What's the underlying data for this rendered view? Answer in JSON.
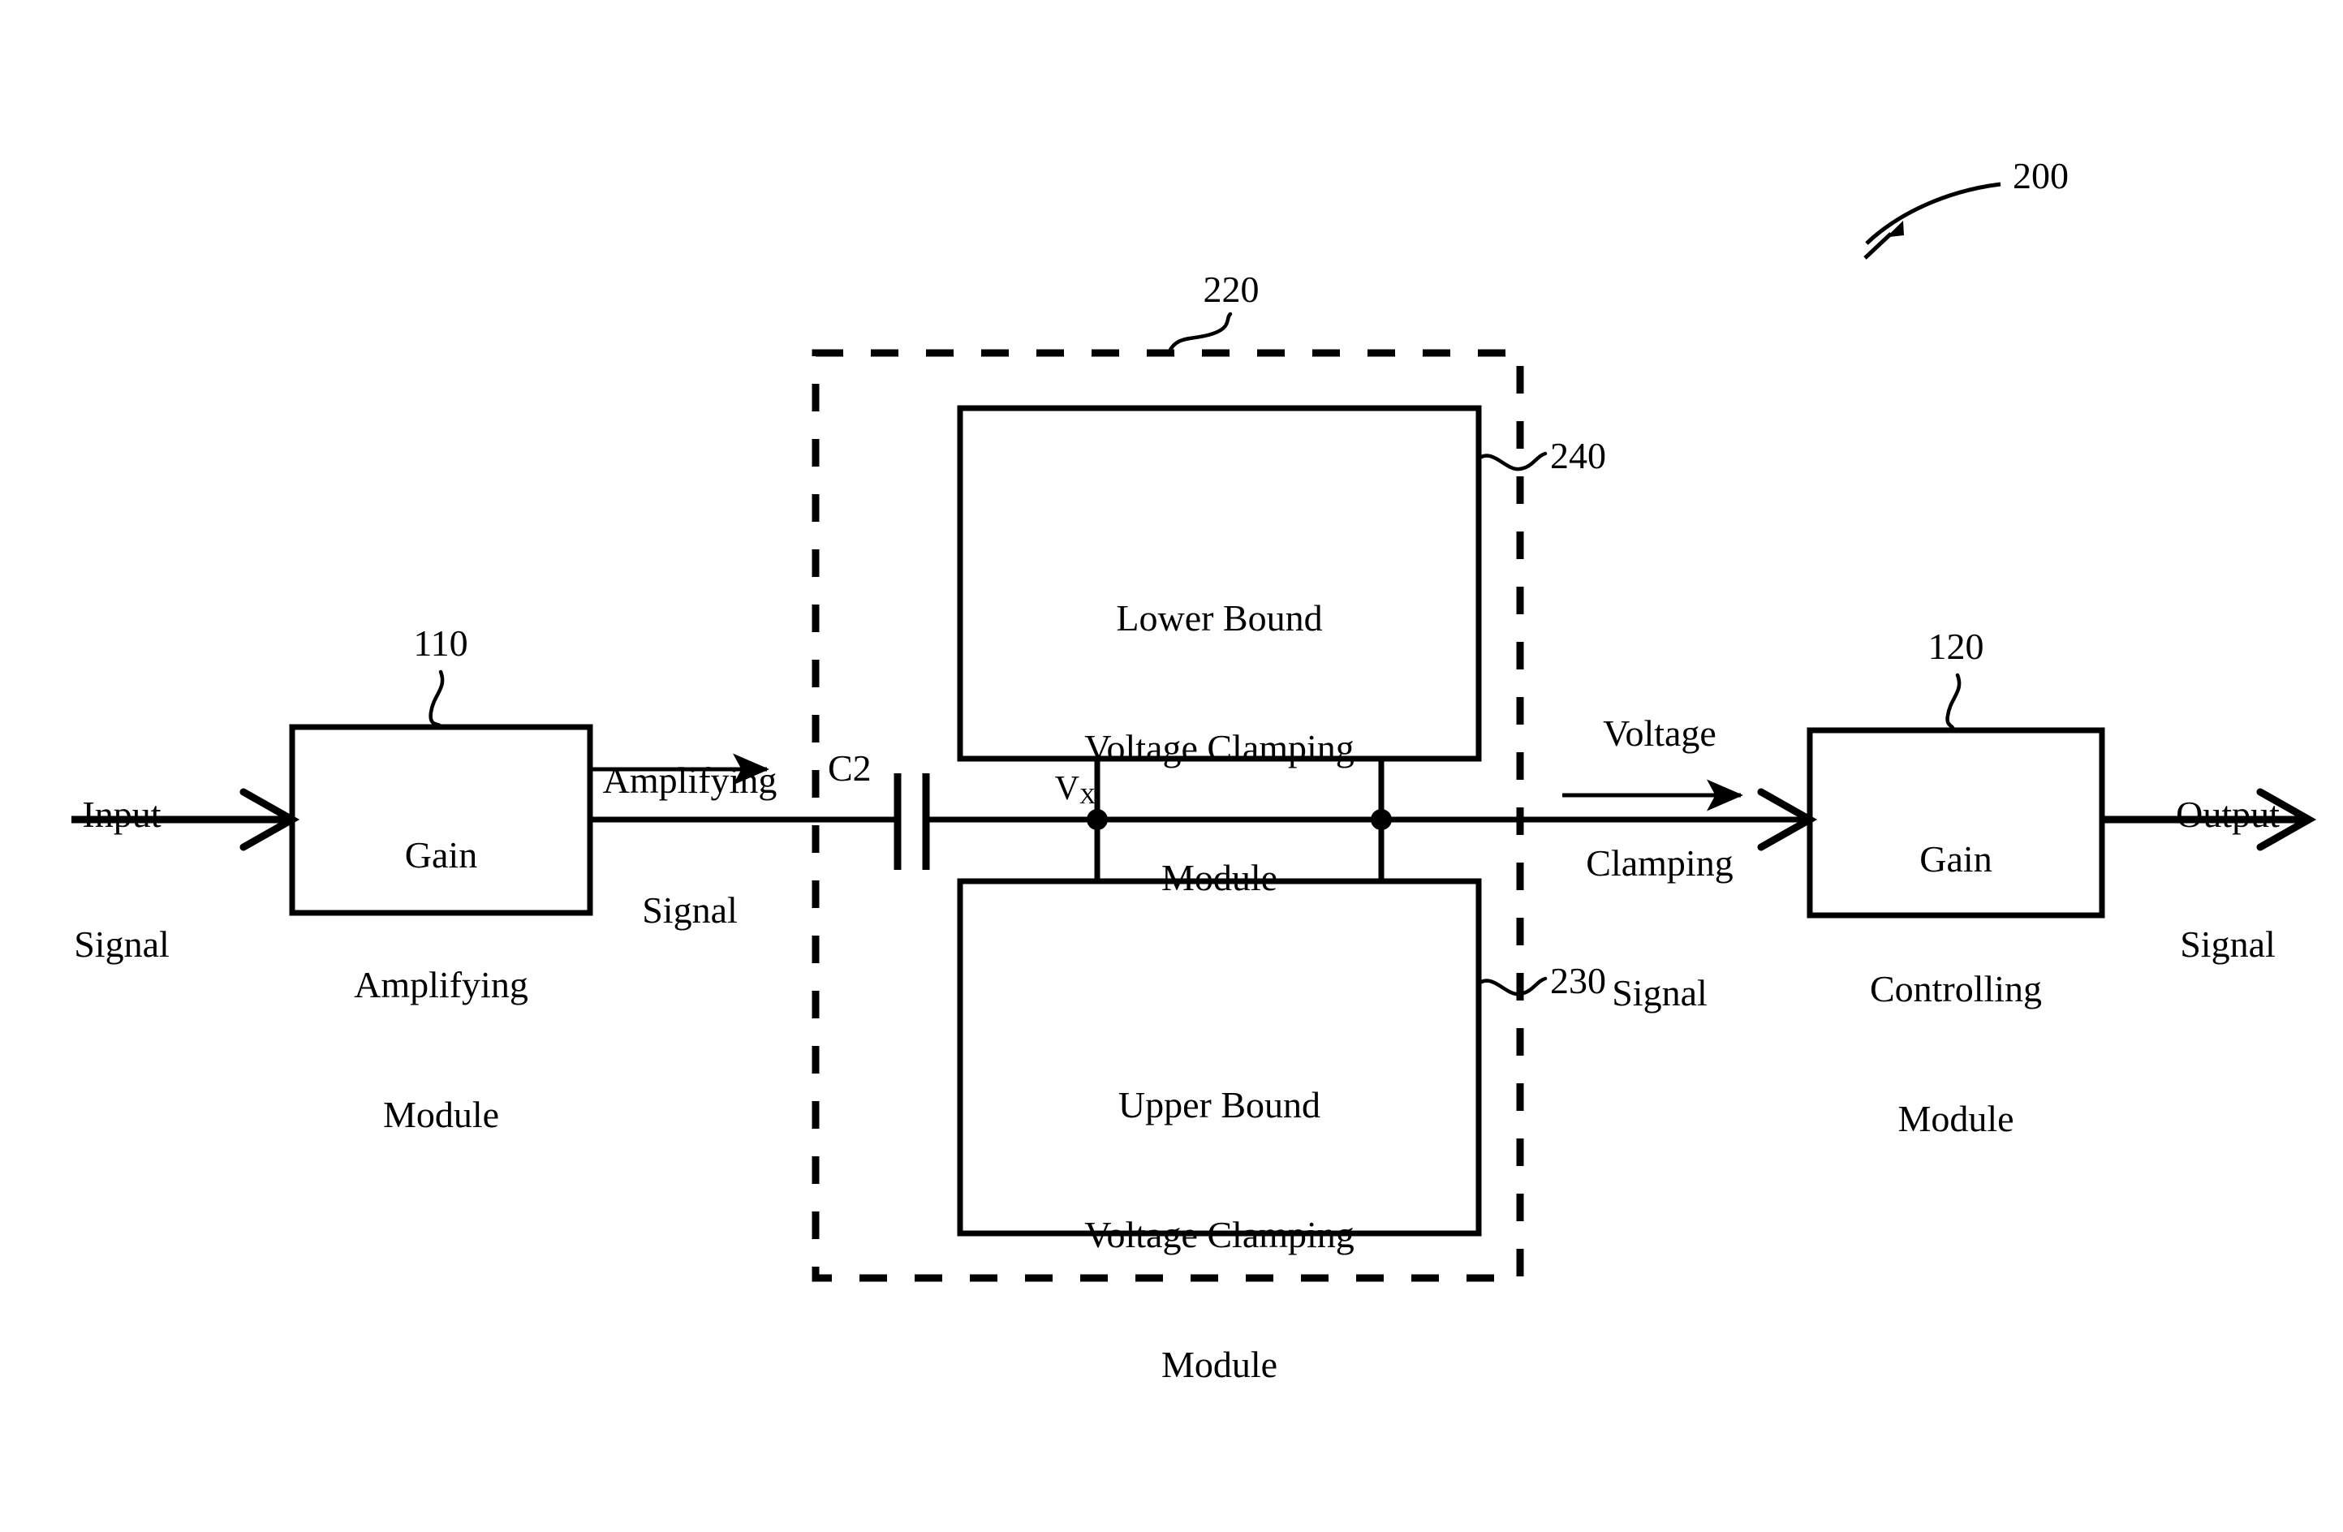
{
  "figure": {
    "type": "patent-block-diagram",
    "reference_numeral_main": "200"
  },
  "blocks": {
    "gain_amplifying": {
      "lines": [
        "Gain",
        "Amplifying",
        "Module"
      ],
      "ref": "110"
    },
    "gain_controlling": {
      "lines": [
        "Gain",
        "Controlling",
        "Module"
      ],
      "ref": "120"
    },
    "lower_bound_clamping": {
      "lines": [
        "Lower Bound",
        "Voltage Clamping",
        "Module"
      ],
      "ref": "240"
    },
    "upper_bound_clamping": {
      "lines": [
        "Upper Bound",
        "Voltage Clamping",
        "Module"
      ],
      "ref": "230"
    },
    "clamping_group": {
      "ref": "220"
    }
  },
  "signals": {
    "input": [
      "Input",
      "Signal"
    ],
    "amplifying": [
      "Amplifying",
      "Signal"
    ],
    "voltage_clamping": [
      "Voltage",
      "Clamping",
      "Signal"
    ],
    "output": [
      "Output",
      "Signal"
    ]
  },
  "components": {
    "capacitor_label": "C2",
    "node_label_v": "V",
    "node_label_sub": "X"
  },
  "colors": {
    "stroke": "#000000",
    "background": "#ffffff"
  }
}
